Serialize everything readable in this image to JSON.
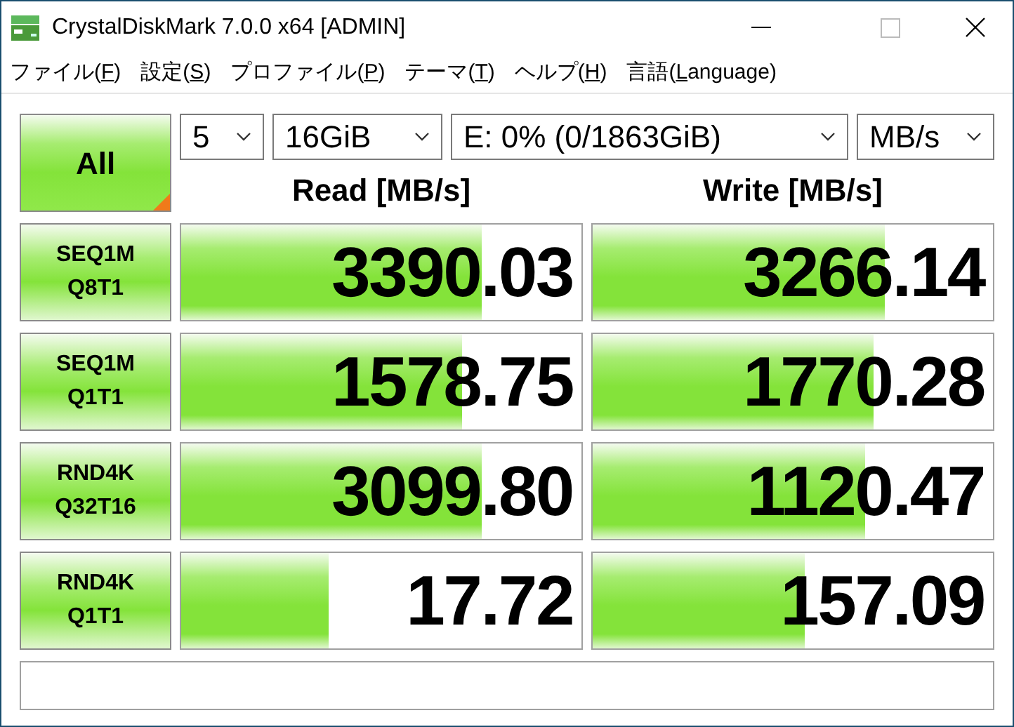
{
  "window": {
    "title": "CrystalDiskMark 7.0.0 x64 [ADMIN]"
  },
  "menu": [
    {
      "text": "ファイル(",
      "mnemonic": "F",
      "tail": ")"
    },
    {
      "text": "設定(",
      "mnemonic": "S",
      "tail": ")"
    },
    {
      "text": "プロファイル(",
      "mnemonic": "P",
      "tail": ")"
    },
    {
      "text": "テーマ(",
      "mnemonic": "T",
      "tail": ")"
    },
    {
      "text": "ヘルプ(",
      "mnemonic": "H",
      "tail": ")"
    },
    {
      "text": "言語(",
      "mnemonic": "L",
      "tail": "anguage)"
    }
  ],
  "all_button": {
    "label": "All"
  },
  "options": {
    "count": "5",
    "size": "16GiB",
    "drive": "E: 0% (0/1863GiB)",
    "unit": "MB/s"
  },
  "headers": {
    "read": "Read [MB/s]",
    "write": "Write [MB/s]"
  },
  "tests": [
    {
      "name": "SEQ1M",
      "params": "Q8T1",
      "read": {
        "value": "3390.03",
        "level": 0.75
      },
      "write": {
        "value": "3266.14",
        "level": 0.73
      }
    },
    {
      "name": "SEQ1M",
      "params": "Q1T1",
      "read": {
        "value": "1578.75",
        "level": 0.7
      },
      "write": {
        "value": "1770.28",
        "level": 0.7
      }
    },
    {
      "name": "RND4K",
      "params": "Q32T16",
      "read": {
        "value": "3099.80",
        "level": 0.75
      },
      "write": {
        "value": "1120.47",
        "level": 0.68
      }
    },
    {
      "name": "RND4K",
      "params": "Q1T1",
      "read": {
        "value": "17.72",
        "level": 0.37
      },
      "write": {
        "value": "157.09",
        "level": 0.53
      }
    }
  ]
}
